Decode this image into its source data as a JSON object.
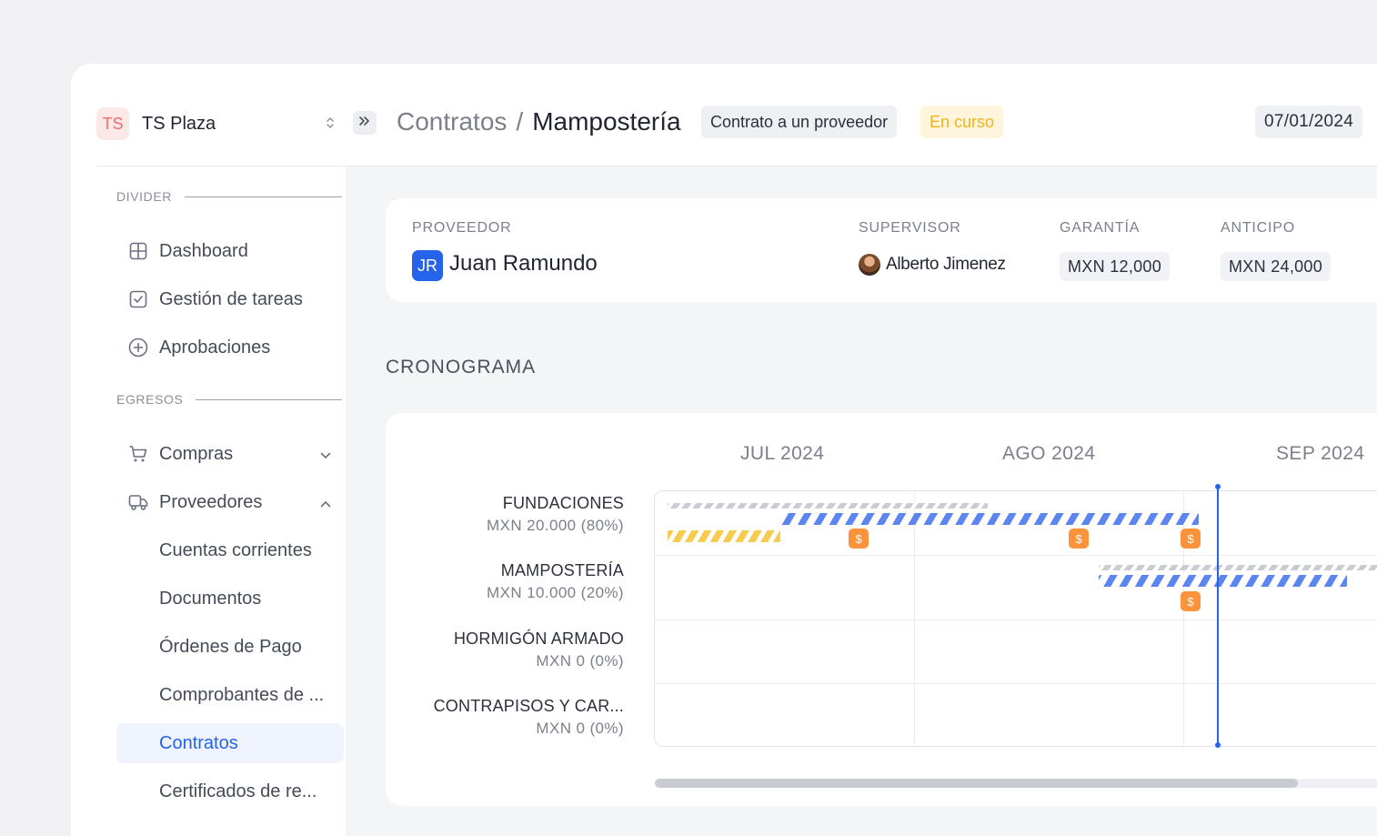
{
  "workspace": {
    "initials": "TS",
    "name": "TS Plaza"
  },
  "sidebar": {
    "section_divider": "DIVIDER",
    "section_egresos": "EGRESOS",
    "items": [
      {
        "label": "Dashboard",
        "icon": "grid-icon"
      },
      {
        "label": "Gestión de tareas",
        "icon": "checkbox-icon"
      },
      {
        "label": "Aprobaciones",
        "icon": "plus-circle-icon"
      },
      {
        "label": "Compras",
        "icon": "cart-icon"
      },
      {
        "label": "Proveedores",
        "icon": "truck-icon"
      },
      {
        "label": "Cuentas corrientes"
      },
      {
        "label": "Documentos"
      },
      {
        "label": "Órdenes de Pago"
      },
      {
        "label": "Comprobantes de ..."
      },
      {
        "label": "Contratos",
        "active": true
      },
      {
        "label": "Certificados de re..."
      }
    ]
  },
  "header": {
    "breadcrumb_parent": "Contratos",
    "breadcrumb_sep": "/",
    "breadcrumb_current": "Mampostería",
    "type_tag": "Contrato a un proveedor",
    "status_tag": "En curso",
    "date": "07/01/2024"
  },
  "info": {
    "proveedor_label": "PROVEEDOR",
    "proveedor_initials": "JR",
    "proveedor_name": "Juan Ramundo",
    "supervisor_label": "SUPERVISOR",
    "supervisor_name": "Alberto Jimenez",
    "garantia_label": "GARANTÍA",
    "garantia_value": "MXN 12,000",
    "anticipo_label": "ANTICIPO",
    "anticipo_value": "MXN 24,000"
  },
  "cronograma": {
    "title": "CRONOGRAMA",
    "months": [
      "JUL 2024",
      "AGO 2024",
      "SEP 2024"
    ],
    "rows": [
      {
        "name": "FUNDACIONES",
        "value": "MXN 20.000 (80%)"
      },
      {
        "name": "MAMPOSTERÍA",
        "value": "MXN 10.000 (20%)"
      },
      {
        "name": "HORMIGÓN ARMADO",
        "value": "MXN 0 (0%)"
      },
      {
        "name": "CONTRAPISOS Y CAR...",
        "value": "MXN 0 (0%)"
      }
    ],
    "payment_symbol": "$"
  },
  "colors": {
    "accent": "#2563eb",
    "status": "#f2b21a",
    "payment": "#fb923c",
    "planned": "#5b86f0",
    "advance": "#f6cb4e"
  }
}
